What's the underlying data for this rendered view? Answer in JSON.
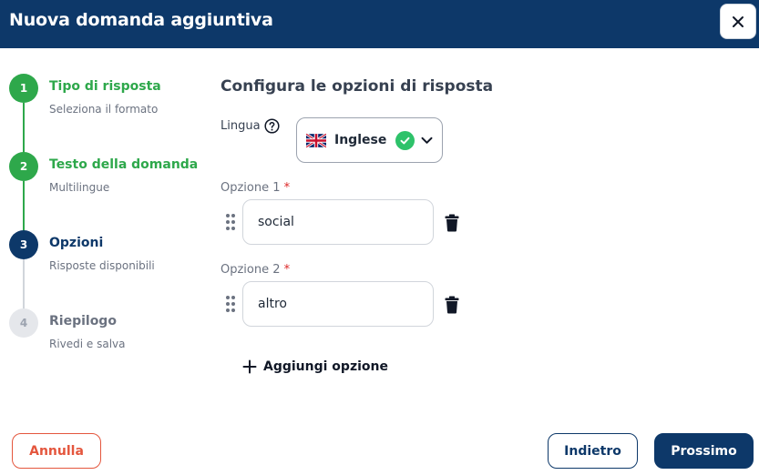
{
  "header": {
    "title": "Nuova domanda aggiuntiva",
    "close_icon": "close-icon"
  },
  "stepper": {
    "steps": [
      {
        "number": "1",
        "title": "Tipo di risposta",
        "subtitle": "Seleziona il formato",
        "state": "done"
      },
      {
        "number": "2",
        "title": "Testo della domanda",
        "subtitle": "Multilingue",
        "state": "done"
      },
      {
        "number": "3",
        "title": "Opzioni",
        "subtitle": "Risposte disponibili",
        "state": "active"
      },
      {
        "number": "4",
        "title": "Riepilogo",
        "subtitle": "Rivedi e salva",
        "state": "todo"
      }
    ]
  },
  "form": {
    "section_title": "Configura le opzioni di risposta",
    "language": {
      "label": "Lingua",
      "help_icon": "help-circle-icon",
      "selected": "Inglese",
      "flag_icon": "uk-flag-icon",
      "status_icon": "check-circle-icon",
      "dropdown_icon": "chevron-down-icon"
    },
    "options": [
      {
        "label": "Opzione 1",
        "required_mark": "*",
        "value": "social"
      },
      {
        "label": "Opzione 2",
        "required_mark": "*",
        "value": "altro"
      }
    ],
    "add_option_label": "Aggiungi opzione"
  },
  "footer": {
    "cancel_label": "Annulla",
    "back_label": "Indietro",
    "next_label": "Prossimo"
  },
  "colors": {
    "primary": "#0d3869",
    "success": "#2ea84b",
    "danger": "#e4563d"
  }
}
